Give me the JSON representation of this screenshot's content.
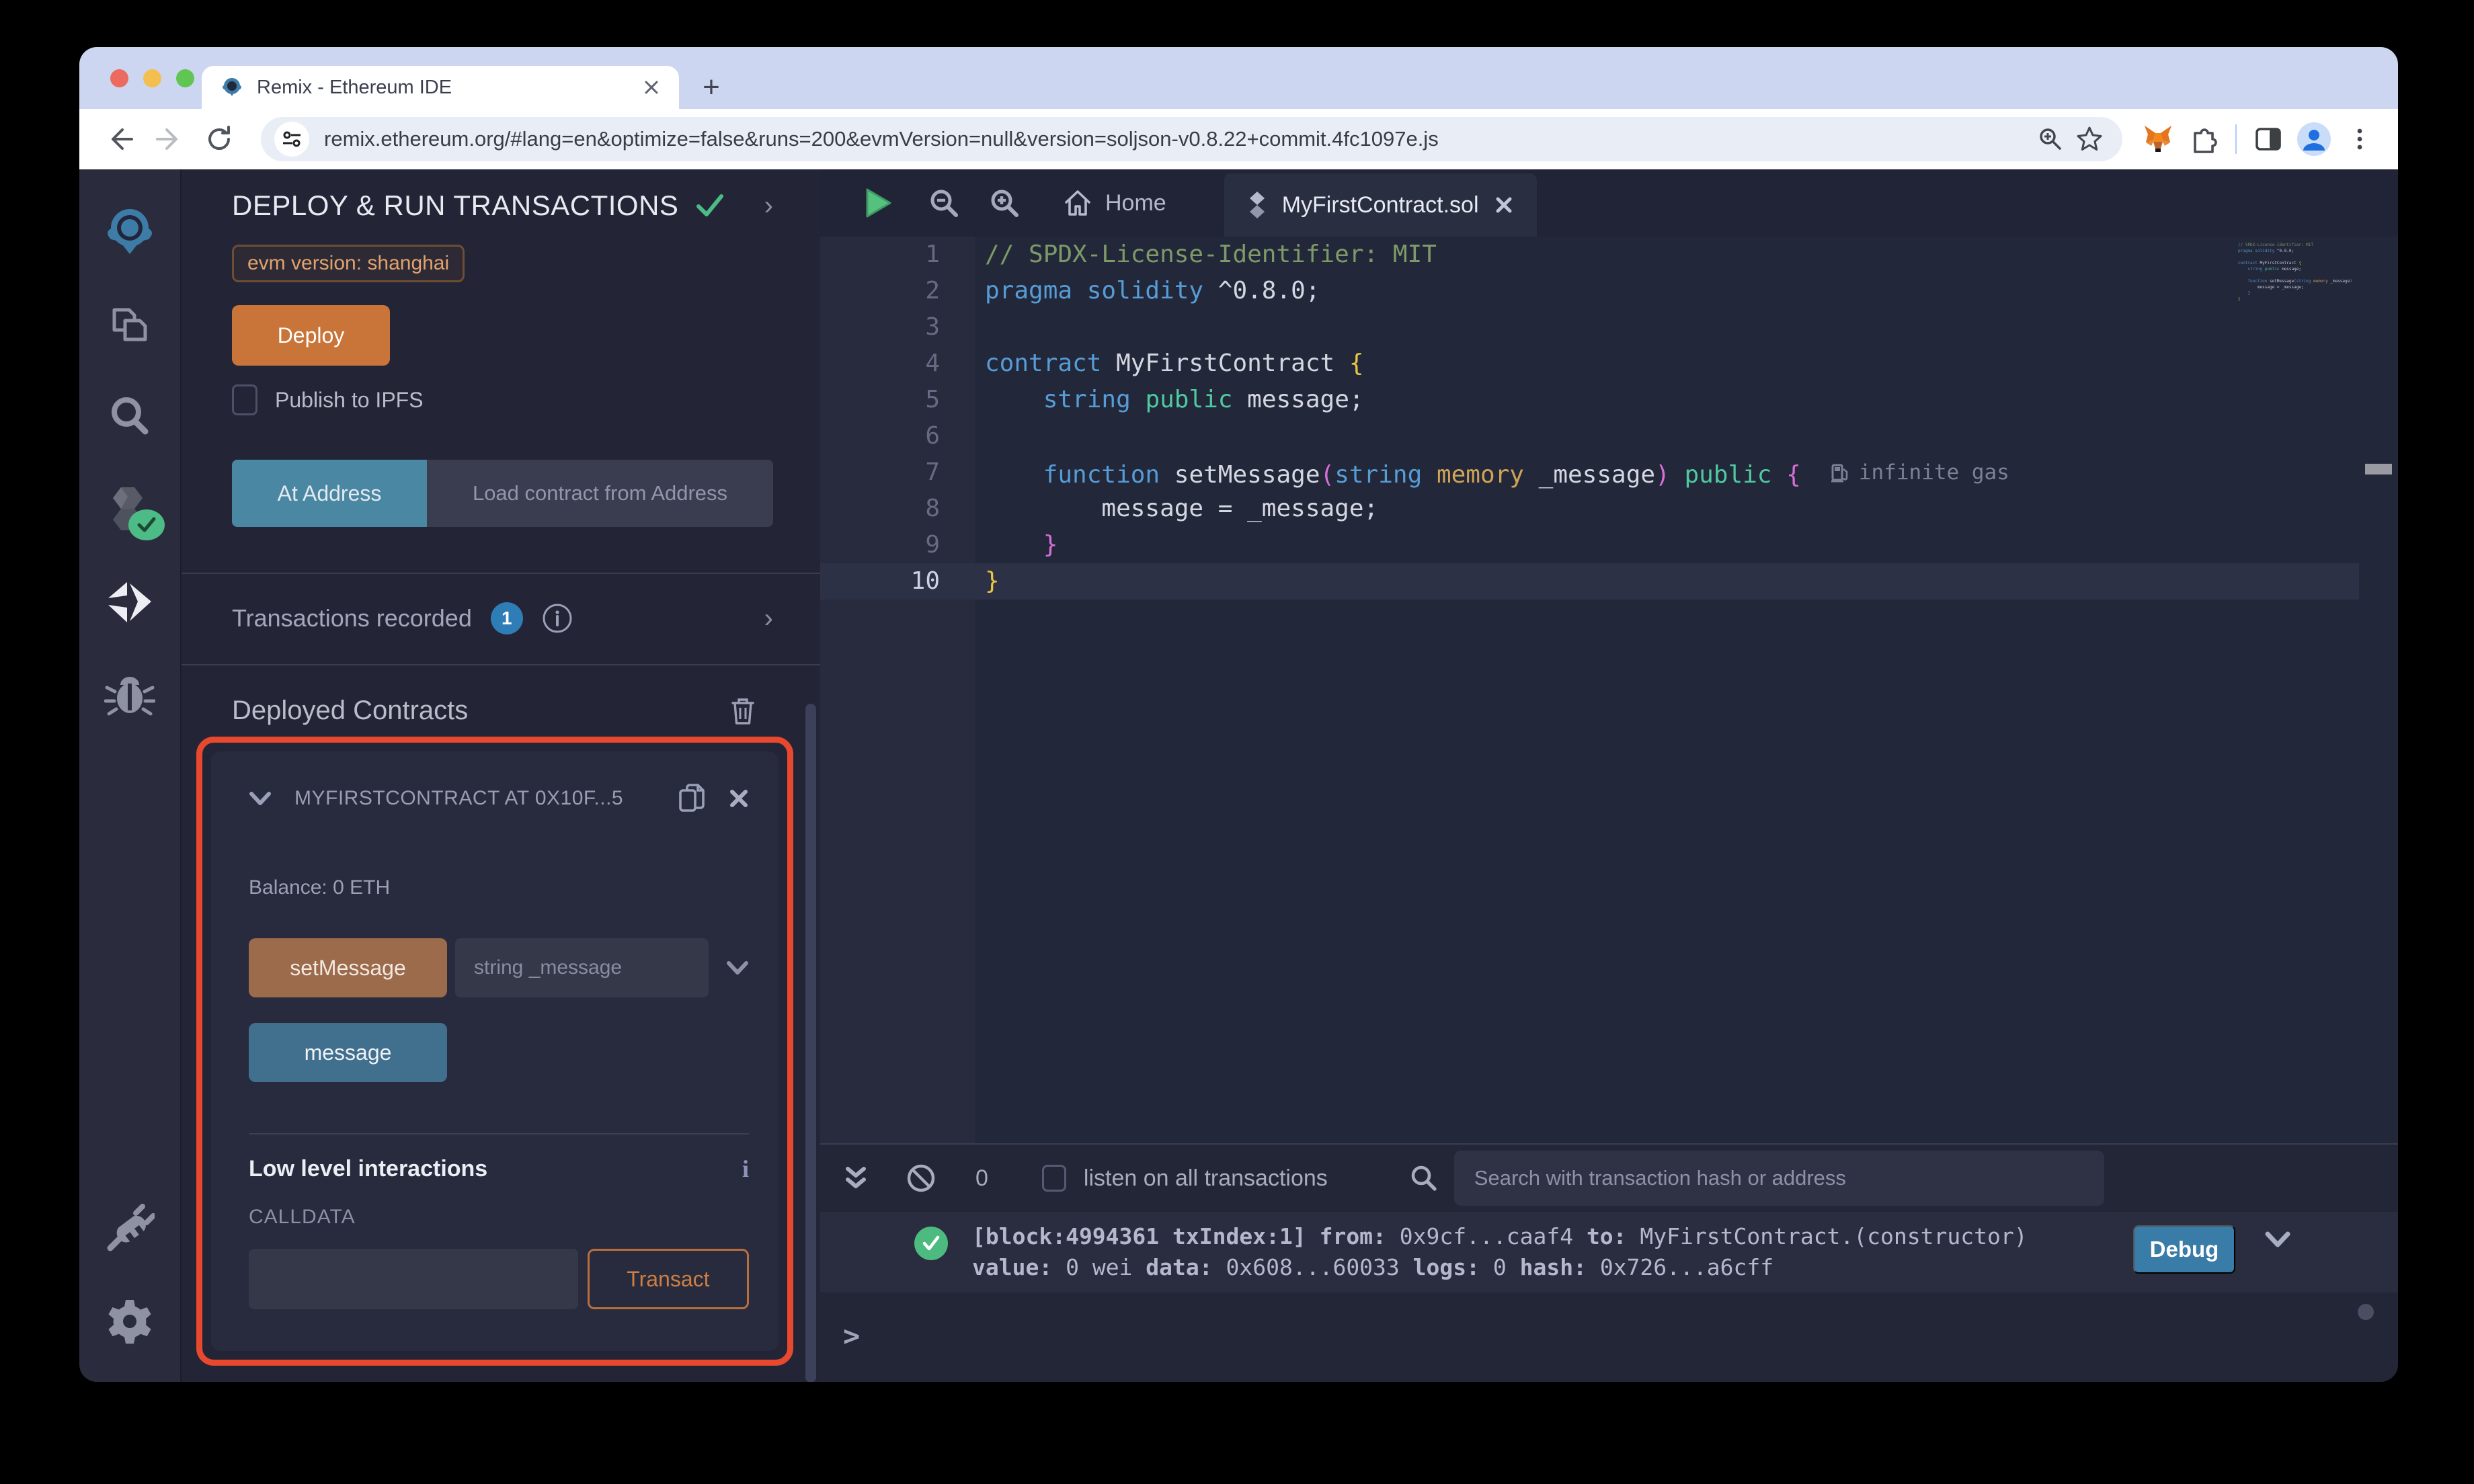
{
  "browser": {
    "tab_title": "Remix - Ethereum IDE",
    "new_tab": "+",
    "url": "remix.ethereum.org/#lang=en&optimize=false&runs=200&evmVersion=null&version=soljson-v0.8.22+commit.4fc1097e.js"
  },
  "rail": {
    "icons": [
      "remix-logo",
      "file-explorer",
      "search",
      "solidity-compiler",
      "deploy-and-run",
      "debugger",
      "plugin-manager",
      "settings"
    ]
  },
  "panel": {
    "title": "DEPLOY & RUN TRANSACTIONS",
    "evm_badge": "evm version: shanghai",
    "deploy_label": "Deploy",
    "publish_label": "Publish to IPFS",
    "at_address_label": "At Address",
    "load_contract_label": "Load contract from Address",
    "transactions_label": "Transactions recorded",
    "tx_count": "1",
    "deployed_label": "Deployed Contracts",
    "card": {
      "title": "MYFIRSTCONTRACT AT 0X10F...5",
      "balance": "Balance: 0 ETH",
      "set_message_label": "setMessage",
      "param_placeholder": "string _message",
      "message_label": "message",
      "low_level_label": "Low level interactions",
      "info_glyph": "i",
      "calldata_label": "CALLDATA",
      "transact_label": "Transact"
    }
  },
  "editor": {
    "tab_home": "Home",
    "tab_file": "MyFirstContract.sol",
    "gas_annotation": "infinite gas",
    "code": [
      {
        "n": "1",
        "t": [
          [
            "c",
            "// SPDX-License-Identifier: MIT"
          ]
        ]
      },
      {
        "n": "2",
        "t": [
          [
            "k",
            "pragma solidity"
          ],
          [
            "p",
            " ^0.8.0;"
          ]
        ]
      },
      {
        "n": "3",
        "t": []
      },
      {
        "n": "4",
        "t": [
          [
            "k",
            "contract"
          ],
          [
            "p",
            " MyFirstContract "
          ],
          [
            "y2",
            "{"
          ]
        ]
      },
      {
        "n": "5",
        "t": [
          [
            "p",
            "    "
          ],
          [
            "k",
            "string"
          ],
          [
            "p",
            " "
          ],
          [
            "g",
            "public"
          ],
          [
            "p",
            " message;"
          ]
        ]
      },
      {
        "n": "6",
        "t": []
      },
      {
        "n": "7",
        "t": [
          [
            "p",
            "    "
          ],
          [
            "k",
            "function"
          ],
          [
            "p",
            " setMessage"
          ],
          [
            "m",
            "("
          ],
          [
            "k",
            "string"
          ],
          [
            "p",
            " "
          ],
          [
            "o",
            "memory"
          ],
          [
            "p",
            " _message"
          ],
          [
            "m",
            ")"
          ],
          [
            "p",
            " "
          ],
          [
            "g",
            "public"
          ],
          [
            "p",
            " "
          ],
          [
            "m",
            "{"
          ]
        ],
        "gas": true
      },
      {
        "n": "8",
        "t": [
          [
            "p",
            "        message = _message;"
          ]
        ]
      },
      {
        "n": "9",
        "t": [
          [
            "p",
            "    "
          ],
          [
            "m",
            "}"
          ]
        ]
      },
      {
        "n": "10",
        "t": [
          [
            "y2",
            "}"
          ]
        ],
        "active": true
      }
    ]
  },
  "terminal": {
    "count": "0",
    "listen_label": "listen on all transactions",
    "search_placeholder": "Search with transaction hash or address",
    "log": [
      [
        [
          "b",
          "[block:4994361 txIndex:1]"
        ],
        [
          "p",
          "  "
        ],
        [
          "b",
          "from:"
        ],
        [
          "p",
          " 0x9cf...caaf4 "
        ],
        [
          "b",
          "to:"
        ],
        [
          "p",
          " MyFirstContract.(constructor)"
        ]
      ],
      [
        [
          "b",
          "value:"
        ],
        [
          "p",
          " 0 wei "
        ],
        [
          "b",
          "data:"
        ],
        [
          "p",
          " 0x608...60033 "
        ],
        [
          "b",
          "logs:"
        ],
        [
          "p",
          " 0 "
        ],
        [
          "b",
          "hash:"
        ],
        [
          "p",
          " 0x726...a6cff"
        ]
      ]
    ],
    "debug_label": "Debug",
    "prompt": ">"
  },
  "colors": {
    "accent_orange": "#c97539",
    "accent_blue": "#3a7ca8",
    "highlight_red": "#e8492e",
    "success_green": "#4dbb85"
  }
}
